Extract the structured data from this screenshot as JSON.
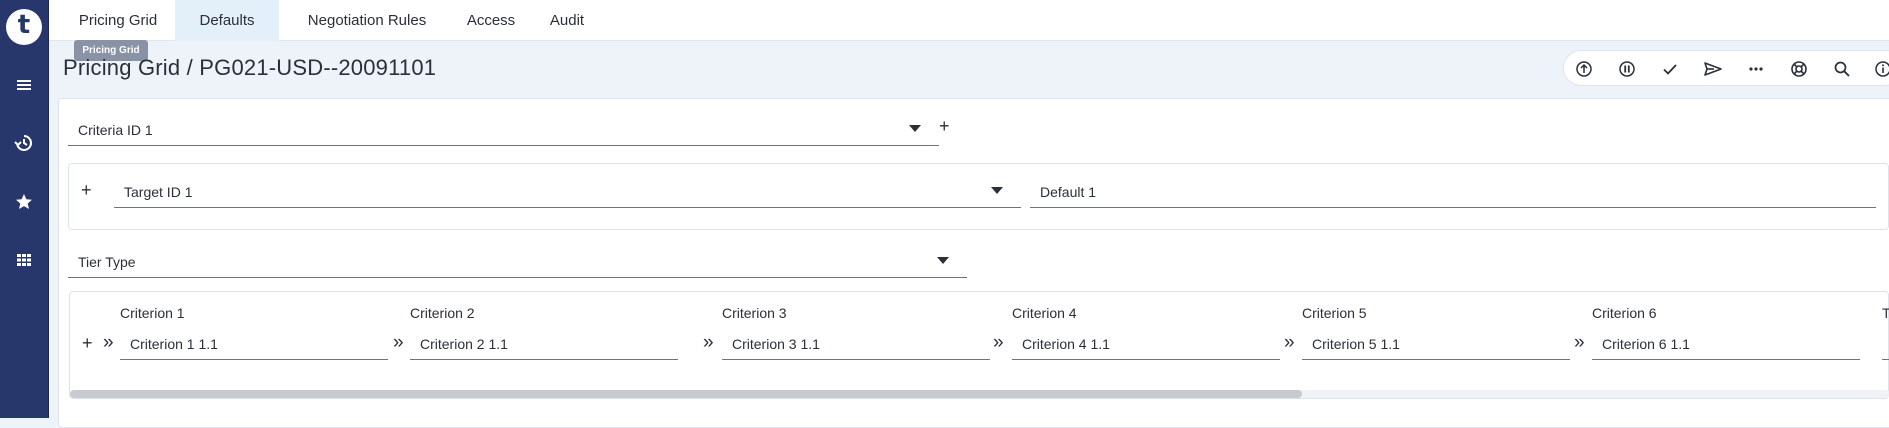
{
  "app": {
    "logo_letter": "t"
  },
  "sidebar": {
    "items": [
      "menu-icon",
      "history-icon",
      "star-icon",
      "apps-icon"
    ]
  },
  "tabs": [
    {
      "label": "Pricing Grid",
      "active": false
    },
    {
      "label": "Defaults",
      "active": true
    },
    {
      "label": "Negotiation Rules",
      "active": false
    },
    {
      "label": "Access",
      "active": false
    },
    {
      "label": "Audit",
      "active": false
    }
  ],
  "tooltip": "Pricing Grid",
  "page": {
    "title": "Pricing Grid / PG021-USD--20091101"
  },
  "toolbar": {
    "icons": [
      "upload-icon",
      "pause-icon",
      "check-icon",
      "send-icon",
      "more-icon",
      "help-ring-icon",
      "search-icon",
      "info-icon"
    ]
  },
  "criteria_id": {
    "value": "Criteria ID 1"
  },
  "target": {
    "id_value": "Target ID 1",
    "default_value": "Default 1"
  },
  "tier_type": {
    "value": "Tier Type"
  },
  "criteria": [
    {
      "head": "Criterion 1",
      "value": "Criterion 1 1.1"
    },
    {
      "head": "Criterion 2",
      "value": "Criterion 2 1.1"
    },
    {
      "head": "Criterion 3",
      "value": "Criterion 3 1.1"
    },
    {
      "head": "Criterion 4",
      "value": "Criterion 4 1.1"
    },
    {
      "head": "Criterion 5",
      "value": "Criterion 5 1.1"
    },
    {
      "head": "Criterion 6",
      "value": "Criterion 6 1.1"
    },
    {
      "head": "T",
      "value": ""
    }
  ],
  "glyphs": {
    "plus": "+",
    "chevron": "»"
  },
  "colors": {
    "sidebar": "#27366b",
    "active_tab": "#e3f0fa",
    "page_bg": "#eef3fa"
  }
}
